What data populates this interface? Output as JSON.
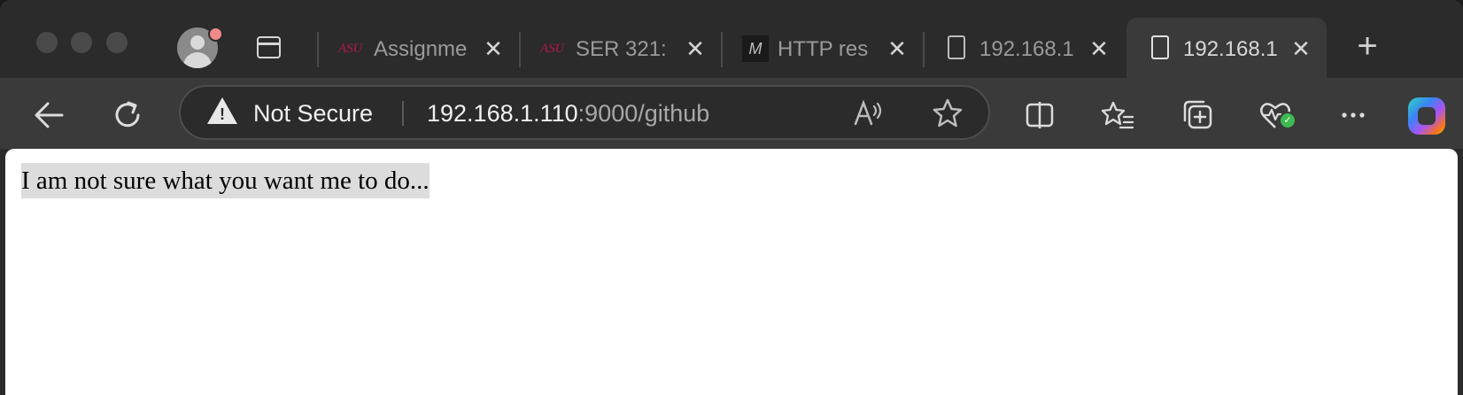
{
  "tabs": [
    {
      "favicon": "asu-logo",
      "favicon_text": "ASU",
      "title": "Assignme",
      "active": false
    },
    {
      "favicon": "asu-logo",
      "favicon_text": "ASU",
      "title": "SER 321:",
      "active": false
    },
    {
      "favicon": "mdn-logo",
      "favicon_text": "M",
      "title": "HTTP res",
      "active": false
    },
    {
      "favicon": "document-icon",
      "favicon_text": "",
      "title": "192.168.1",
      "active": false
    },
    {
      "favicon": "document-icon",
      "favicon_text": "",
      "title": "192.168.1",
      "active": true
    }
  ],
  "tab_close_glyph": "✕",
  "new_tab_glyph": "+",
  "toolbar": {
    "security_label": "Not Secure",
    "url_host": "192.168.1.110",
    "url_rest": ":9000/github"
  },
  "page": {
    "text": "I am not sure what you want me to do..."
  },
  "colors": {
    "chrome_dark": "#2b2b2b",
    "toolbar": "#3a3a3a",
    "selection_highlight": "#dcdcdc",
    "asu_maroon": "#8c1d40",
    "health_green": "#3fb950"
  }
}
